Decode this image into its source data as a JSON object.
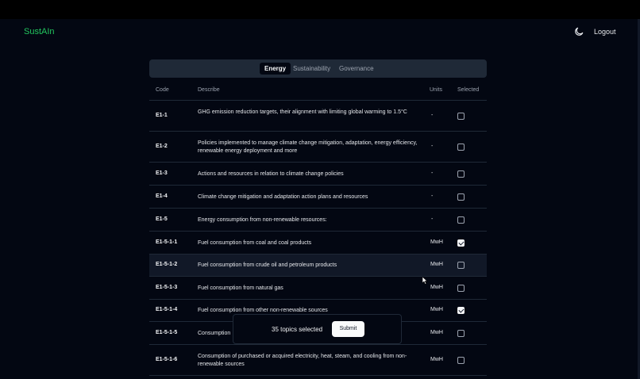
{
  "app": {
    "brand": "SustAIn",
    "logout_label": "Logout",
    "theme_icon": "moon-icon",
    "accent": "#22c55e"
  },
  "tabs": [
    {
      "label": "Energy",
      "active": true
    },
    {
      "label": "Sustainability",
      "active": false
    },
    {
      "label": "Governance",
      "active": false
    }
  ],
  "table": {
    "headers": {
      "code": "Code",
      "describe": "Describe",
      "units": "Units",
      "selected": "Selected"
    },
    "rows": [
      {
        "code": "E1-1",
        "describe": "GHG emission reduction targets, their alignment with limiting global warming to 1.5°C",
        "units": "-",
        "selected": false
      },
      {
        "code": "E1-2",
        "describe": "Policies implemented to manage climate change mitigation, adaptation, energy efficiency, renewable energy deployment and more",
        "units": "-",
        "selected": false
      },
      {
        "code": "E1-3",
        "describe": "Actions and resources in relation to climate change policies",
        "units": "-",
        "selected": false
      },
      {
        "code": "E1-4",
        "describe": "Climate change mitigation and adaptation action plans and resources",
        "units": "-",
        "selected": false
      },
      {
        "code": "E1-5",
        "describe": "Energy consumption from non-renewable resources:",
        "units": "-",
        "selected": false
      },
      {
        "code": "E1-5-1-1",
        "describe": "Fuel consumption from coal and coal products",
        "units": "MwH",
        "selected": true
      },
      {
        "code": "E1-5-1-2",
        "describe": "Fuel consumption from crude oil and petroleum products",
        "units": "MwH",
        "selected": false
      },
      {
        "code": "E1-5-1-3",
        "describe": "Fuel consumption from natural gas",
        "units": "MwH",
        "selected": false
      },
      {
        "code": "E1-5-1-4",
        "describe": "Fuel consumption from other non-renewable sources",
        "units": "MwH",
        "selected": true
      },
      {
        "code": "E1-5-1-5",
        "describe": "Consumption",
        "units": "MwH",
        "selected": false
      },
      {
        "code": "E1-5-1-6",
        "describe": "Consumption of purchased or acquired electricity, heat, steam, and cooling from non-renewable sources",
        "units": "MwH",
        "selected": false
      }
    ]
  },
  "selection_bar": {
    "count_text": "35 topics selected",
    "submit_label": "Submit"
  }
}
